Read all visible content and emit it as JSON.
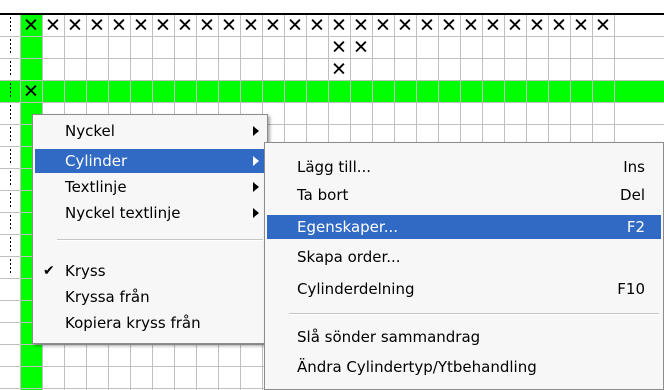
{
  "grid": {
    "colors": {
      "line": "#c0c0c0",
      "green": "#00ff00",
      "cross": "#000000"
    },
    "row_crosses": [
      [
        0,
        1,
        2,
        3,
        4,
        5,
        6,
        7,
        8,
        9,
        10,
        11,
        12,
        13,
        14,
        15,
        16,
        17,
        18,
        19,
        20,
        21,
        22,
        23,
        24,
        25,
        26
      ],
      [
        14,
        15
      ],
      [
        14
      ],
      [
        0
      ]
    ],
    "green_row_index": 3,
    "cross_symbol": "✕"
  },
  "context_menu": {
    "items": [
      {
        "label": "Nyckel",
        "submenu": true
      },
      {
        "label": "Cylinder",
        "submenu": true,
        "highlighted": true
      },
      {
        "label": "Textlinje",
        "submenu": true
      },
      {
        "label": "Nyckel textlinje",
        "submenu": true
      },
      {
        "label": "Kryss",
        "checked": true
      },
      {
        "label": "Kryssa från"
      },
      {
        "label": "Kopiera kryss från"
      }
    ],
    "check_mark": "✔"
  },
  "submenu": {
    "items": [
      {
        "label": "Lägg till...",
        "shortcut": "Ins"
      },
      {
        "label": "Ta bort",
        "shortcut": "Del"
      },
      {
        "label": "Egenskaper...",
        "shortcut": "F2",
        "highlighted": true
      },
      {
        "label": "Skapa order...",
        "shortcut": ""
      },
      {
        "label": "Cylinderdelning",
        "shortcut": "F10"
      },
      {
        "label": "Slå sönder sammandrag",
        "shortcut": ""
      },
      {
        "label": "Ändra Cylindertyp/Ytbehandling",
        "shortcut": ""
      }
    ]
  },
  "colors": {
    "highlight": "#316ac5",
    "menu_bg": "#f7f7f7"
  }
}
